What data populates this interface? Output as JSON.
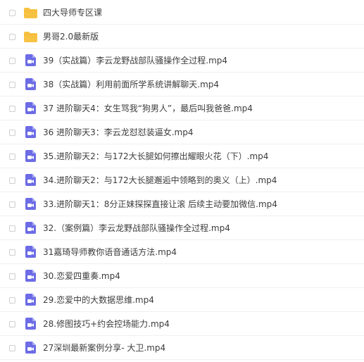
{
  "files": [
    {
      "type": "folder",
      "icon": "folder-icon",
      "name": "四大导师专区课"
    },
    {
      "type": "folder",
      "icon": "folder-icon",
      "name": "男哥2.0最新版"
    },
    {
      "type": "video",
      "icon": "video-file-icon",
      "name": "39（实战篇）李云龙野战部队骚操作全过程.mp4"
    },
    {
      "type": "video",
      "icon": "video-file-icon",
      "name": "38（实战篇）利用前面所学系统讲解聊天.mp4"
    },
    {
      "type": "video",
      "icon": "video-file-icon",
      "name": "37 进阶聊天4：女生骂我“狗男人”，最后叫我爸爸.mp4"
    },
    {
      "type": "video",
      "icon": "video-file-icon",
      "name": "36 进阶聊天3：李云龙怼怼装逼女.mp4"
    },
    {
      "type": "video",
      "icon": "video-file-icon",
      "name": "35.进阶聊天2：与172大长腿如何擦出耀眼火花（下）.mp4"
    },
    {
      "type": "video",
      "icon": "video-file-icon",
      "name": "34.进阶聊天2：与172大长腿邂逅中领略到的奥义（上）.mp4"
    },
    {
      "type": "video",
      "icon": "video-file-icon",
      "name": "33.进阶聊天1：8分正妹探探直接让滚 后续主动要加微信.mp4"
    },
    {
      "type": "video",
      "icon": "video-file-icon",
      "name": "32.（案例篇）李云龙野战部队骚操作全过程.mp4"
    },
    {
      "type": "video",
      "icon": "video-file-icon",
      "name": "31嘉琦导师教你语音通话方法.mp4"
    },
    {
      "type": "video",
      "icon": "video-file-icon",
      "name": "30.恋爱四重奏.mp4"
    },
    {
      "type": "video",
      "icon": "video-file-icon",
      "name": "29.恋爱中的大数据思维.mp4"
    },
    {
      "type": "video",
      "icon": "video-file-icon",
      "name": "28.修图技巧+约会控场能力.mp4"
    },
    {
      "type": "video",
      "icon": "video-file-icon",
      "name": "27深圳最新案例分享- 大卫.mp4"
    }
  ],
  "colors": {
    "folder": "#f7c242",
    "folder_tab": "#f1b22d",
    "video": "#6c6ce6",
    "video_fold": "#a8a8f2",
    "text": "#3c3c3c",
    "divider": "#efefef"
  }
}
